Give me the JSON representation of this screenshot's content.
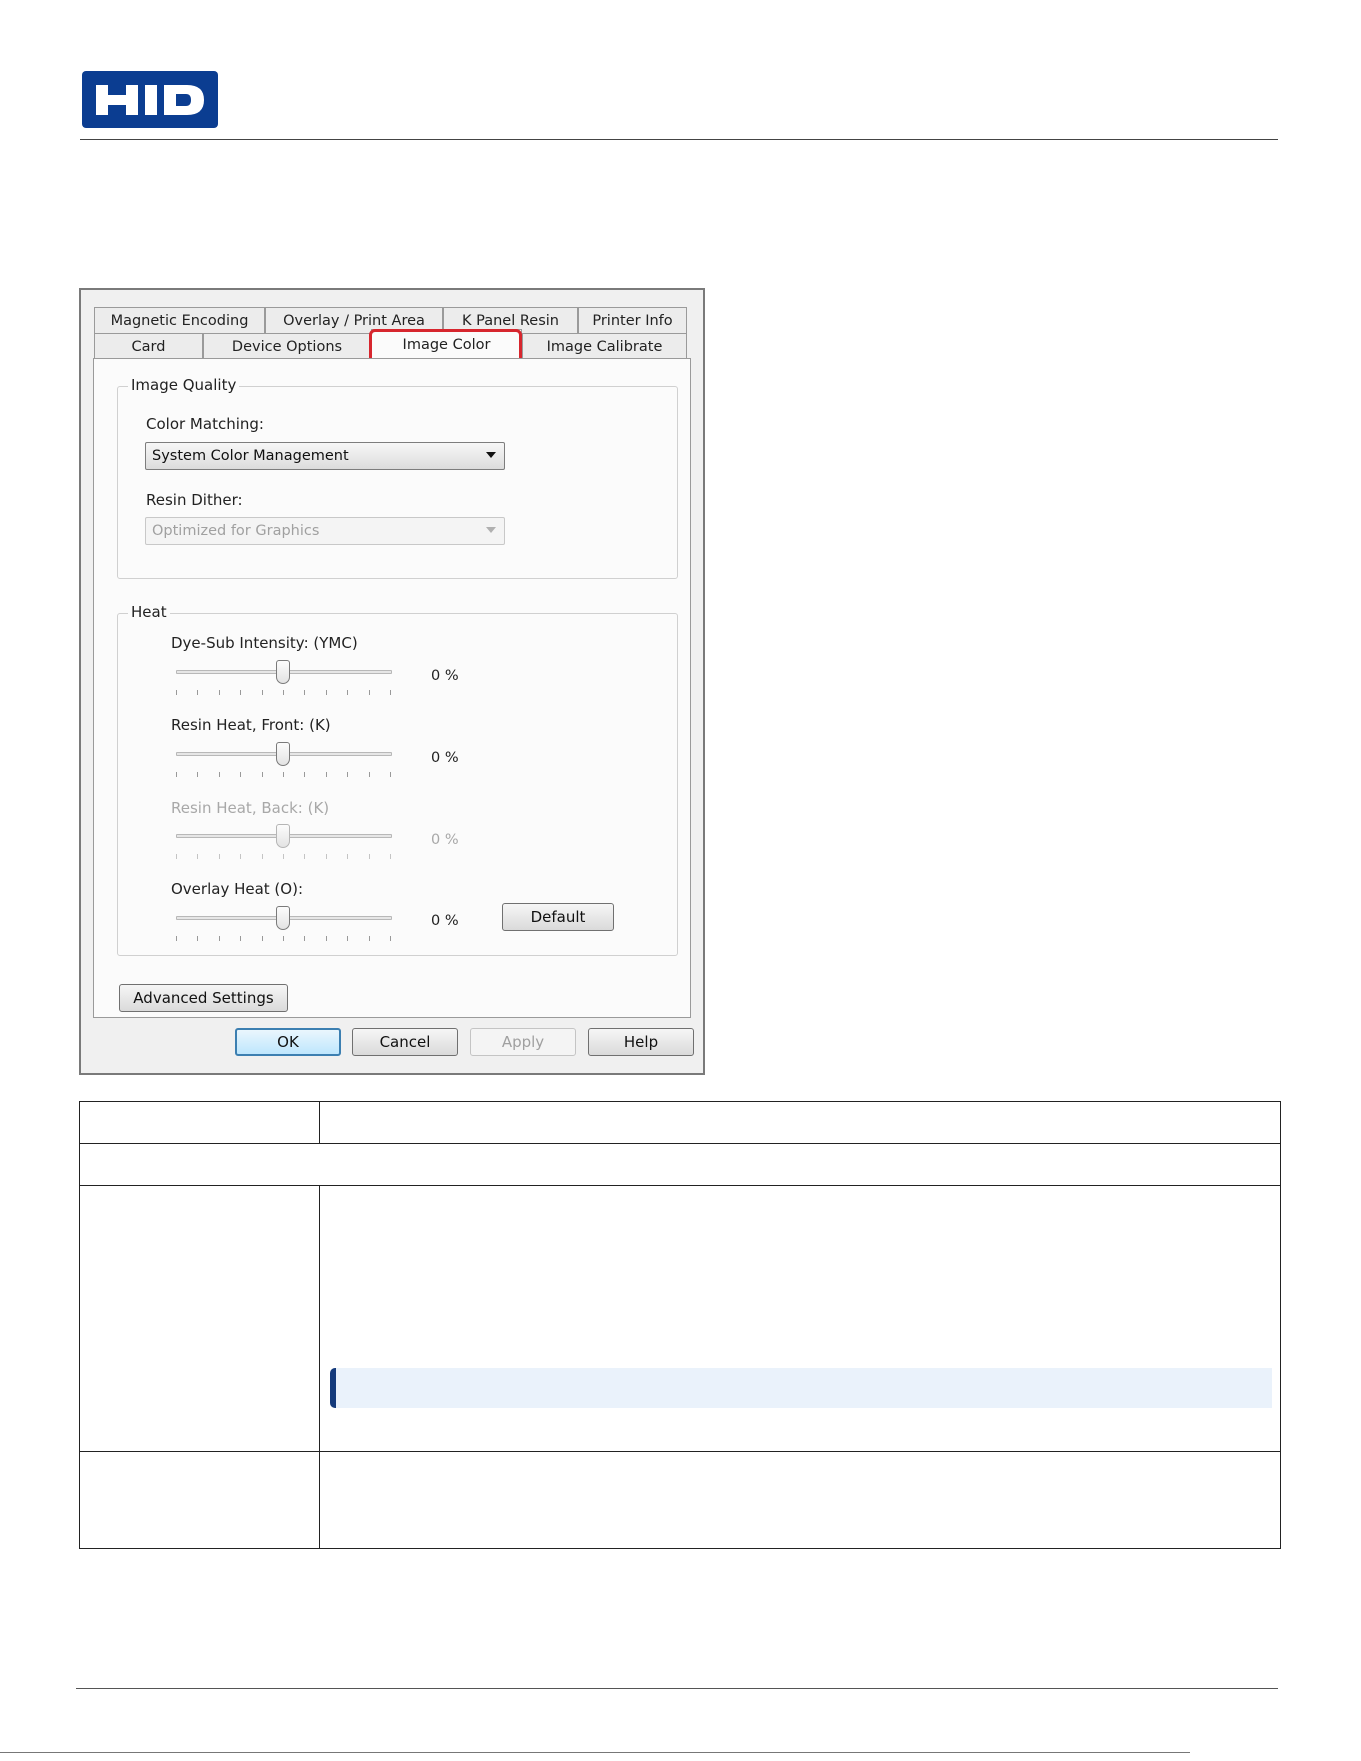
{
  "header": {
    "logo_text": "HID"
  },
  "dialog": {
    "tabs_row1": [
      "Magnetic Encoding",
      "Overlay / Print Area",
      "K Panel Resin",
      "Printer Info"
    ],
    "tabs_row2": [
      "Card",
      "Device Options",
      "Image Color",
      "Image Calibrate"
    ],
    "active_tab": "Image Color",
    "image_quality": {
      "title": "Image Quality",
      "color_matching_label": "Color Matching:",
      "color_matching_value": "System Color Management",
      "resin_dither_label": "Resin Dither:",
      "resin_dither_value": "Optimized for Graphics"
    },
    "heat": {
      "title": "Heat",
      "sliders": [
        {
          "label": "Dye-Sub Intensity: (YMC)",
          "value": 0,
          "value_text": "0  %",
          "enabled": true
        },
        {
          "label": "Resin Heat, Front: (K)",
          "value": 0,
          "value_text": "0  %",
          "enabled": true
        },
        {
          "label": "Resin Heat, Back: (K)",
          "value": 0,
          "value_text": "0  %",
          "enabled": false
        },
        {
          "label": "Overlay Heat  (O):",
          "value": 0,
          "value_text": "0  %",
          "enabled": true
        }
      ],
      "default_button": "Default"
    },
    "advanced_button": "Advanced Settings",
    "buttons": {
      "ok": "OK",
      "cancel": "Cancel",
      "apply": "Apply",
      "help": "Help"
    }
  }
}
